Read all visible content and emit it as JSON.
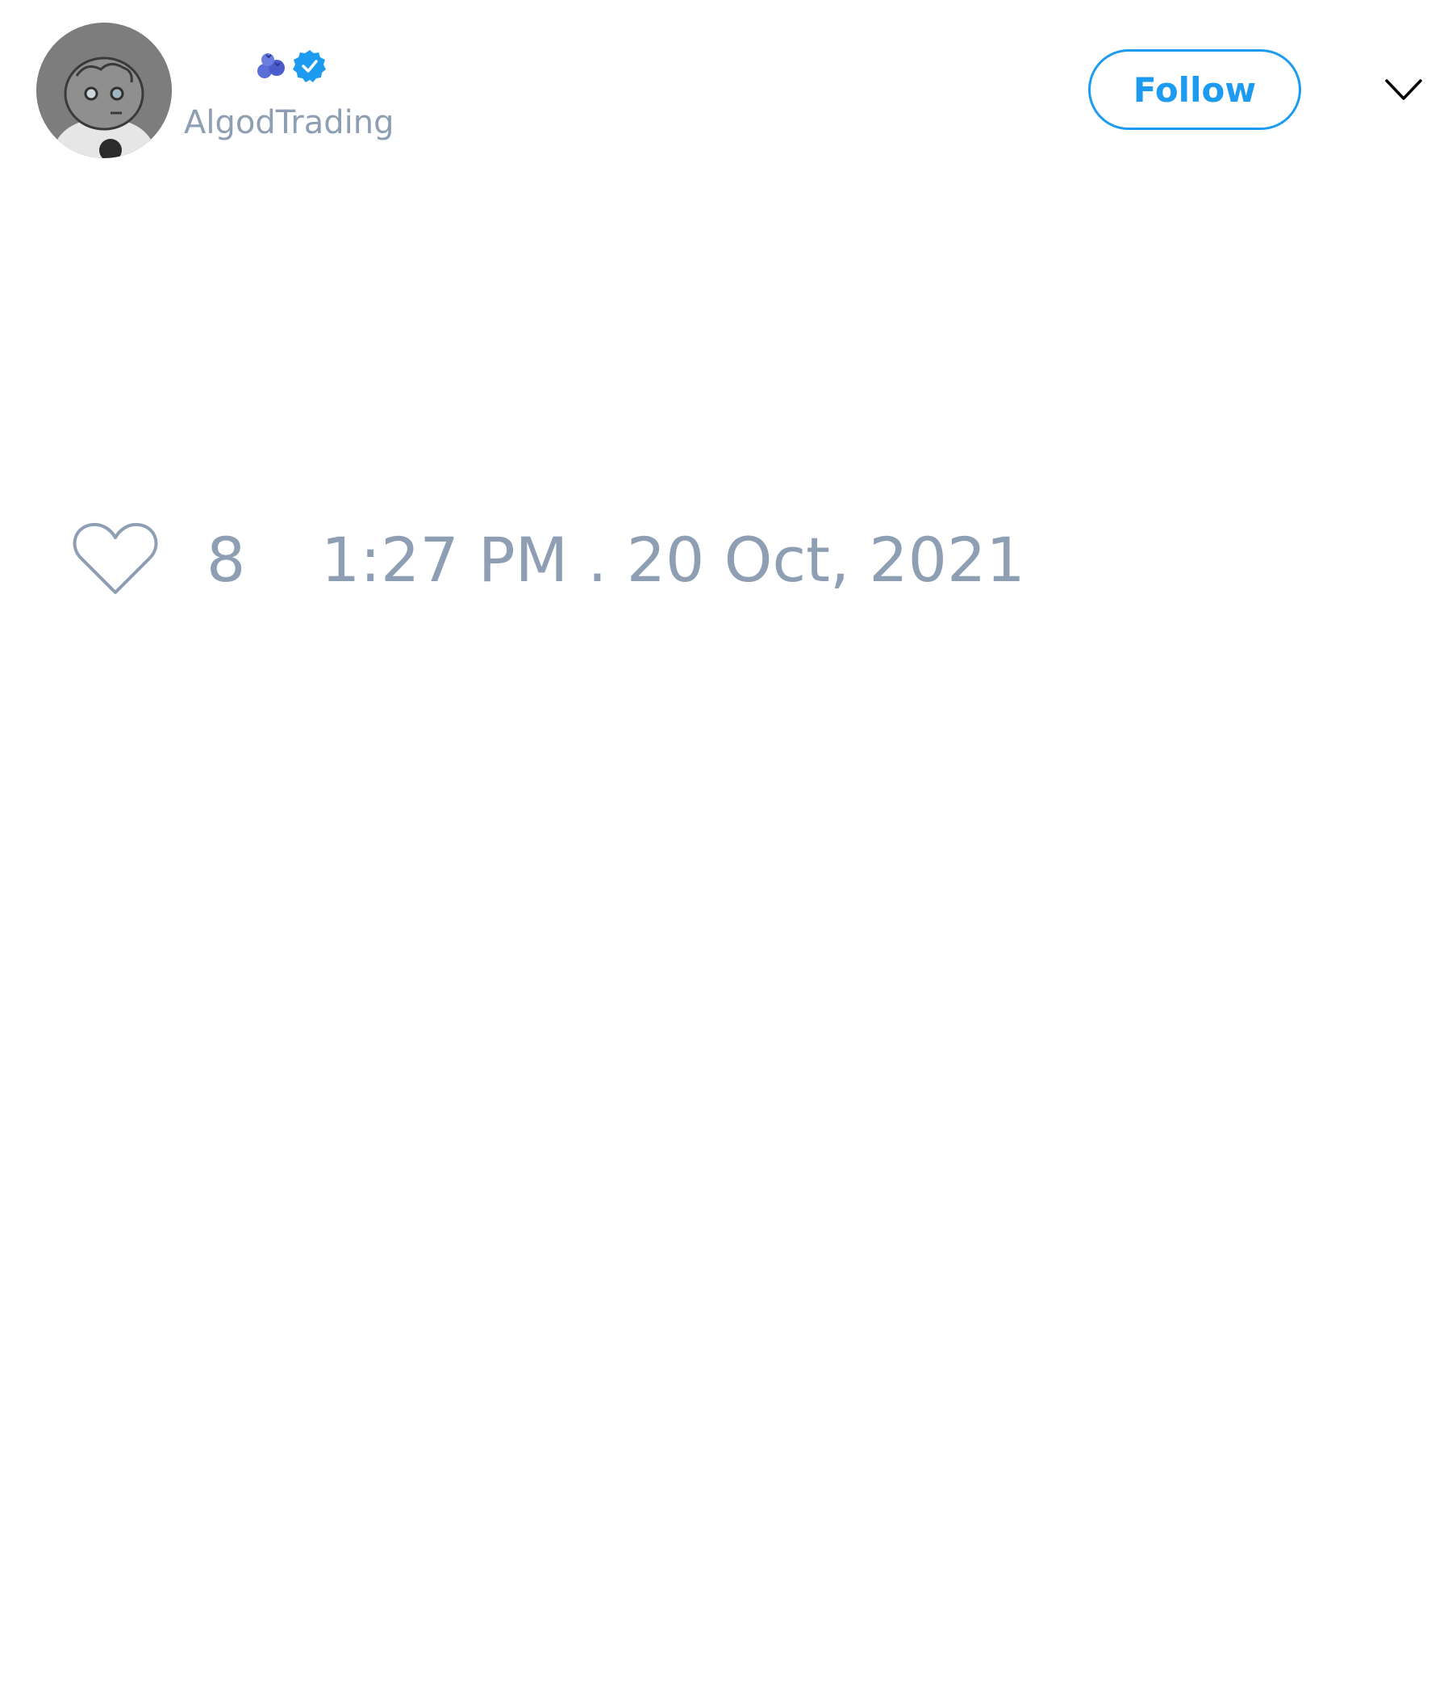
{
  "tweet": {
    "author": {
      "avatar": "avatar-image",
      "name_icons": [
        "blueberries-emoji",
        "verified-badge-icon"
      ],
      "handle": "AlgodTrading"
    },
    "follow_label": "Follow",
    "more_icon": "chevron-down-icon",
    "like_icon": "heart-outline-icon",
    "like_count": "8",
    "timestamp": "1:27 PM . 20 Oct, 2021",
    "colors": {
      "accent": "#1d9bf0",
      "muted_text": "#8e9eb3",
      "background": "#ffffff"
    }
  }
}
